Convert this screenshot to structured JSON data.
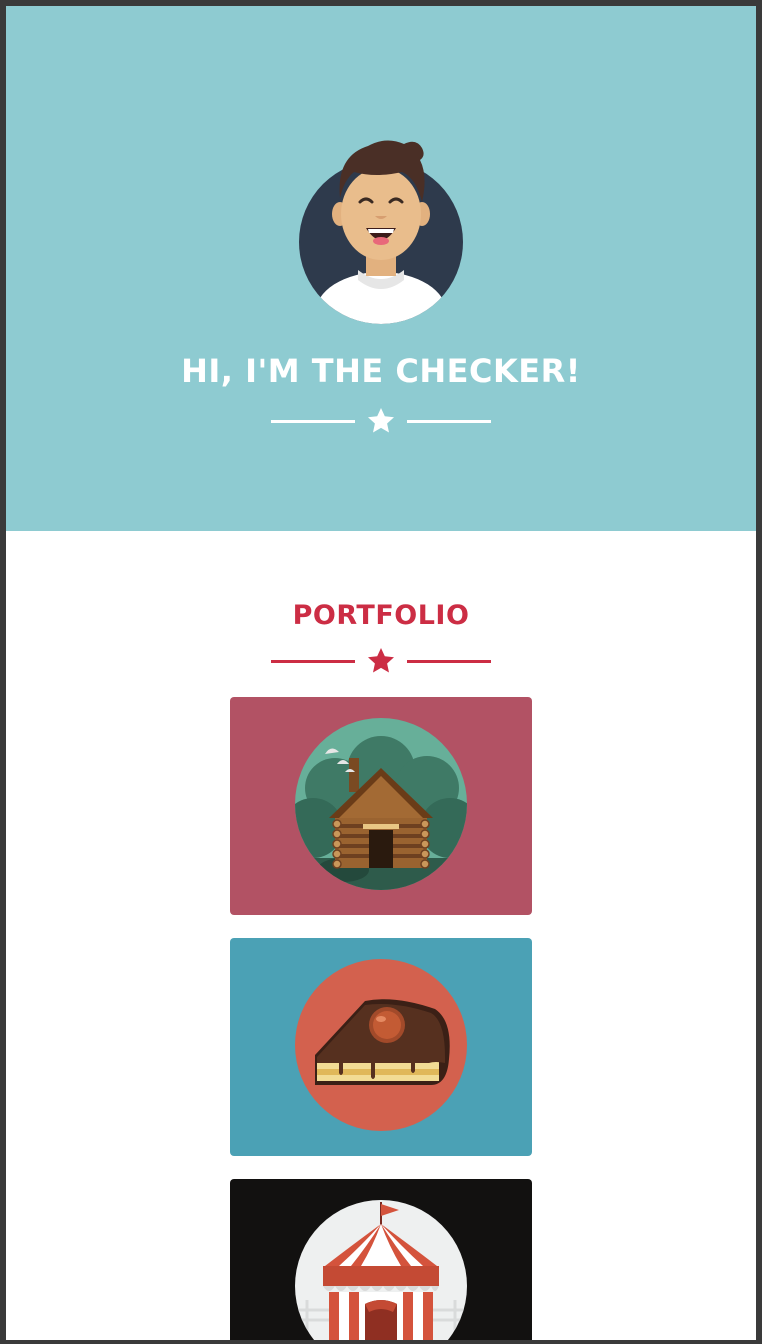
{
  "header": {
    "title": "HI, I'M THE CHECKER!",
    "avatar_icon": "smiling-person-avatar-icon"
  },
  "portfolio": {
    "title": "PORTFOLIO",
    "items": [
      {
        "icon": "log-cabin-icon",
        "background": "#b25264"
      },
      {
        "icon": "cake-slice-icon",
        "background": "#4ba1b5"
      },
      {
        "icon": "circus-tent-icon",
        "background": "#121110"
      }
    ]
  },
  "colors": {
    "hero_bg": "#8ecbd1",
    "accent": "#cc2d44",
    "text_light": "#ffffff"
  }
}
